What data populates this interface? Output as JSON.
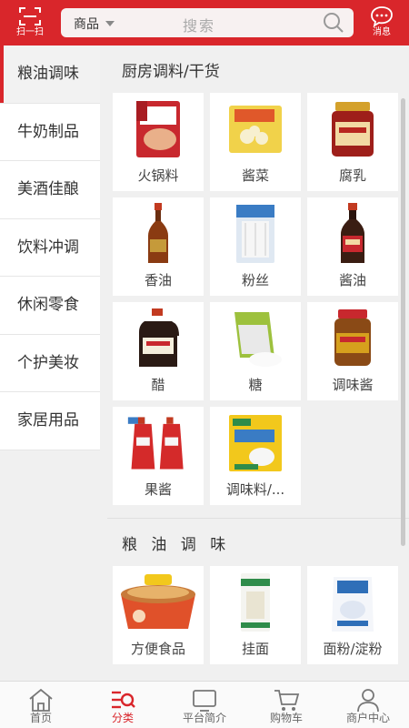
{
  "header": {
    "scan_label": "扫一扫",
    "search_category": "商品",
    "search_placeholder": "搜索",
    "message_label": "消息"
  },
  "sidebar": {
    "items": [
      {
        "label": "粮油调味",
        "active": true
      },
      {
        "label": "牛奶制品"
      },
      {
        "label": "美酒佳酿"
      },
      {
        "label": "饮料冲调"
      },
      {
        "label": "休闲零食"
      },
      {
        "label": "个护美妆"
      },
      {
        "label": "家居用品"
      }
    ]
  },
  "sections": [
    {
      "title": "厨房调料/干货",
      "items": [
        {
          "name": "火锅料",
          "icon": "hotpot-package-icon",
          "color": "#c8282e"
        },
        {
          "name": "酱菜",
          "icon": "pickles-package-icon",
          "color": "#e8c23a"
        },
        {
          "name": "腐乳",
          "icon": "fermented-tofu-jar-icon",
          "color": "#b8261f"
        },
        {
          "name": "香油",
          "icon": "sesame-oil-bottle-icon",
          "color": "#8a3b12"
        },
        {
          "name": "粉丝",
          "icon": "vermicelli-package-icon",
          "color": "#3a7cc4"
        },
        {
          "name": "酱油",
          "icon": "soy-sauce-bottle-icon",
          "color": "#3a1d12"
        },
        {
          "name": "醋",
          "icon": "vinegar-jug-icon",
          "color": "#2a1a14"
        },
        {
          "name": "糖",
          "icon": "sugar-bag-icon",
          "color": "#9dc13d"
        },
        {
          "name": "调味酱",
          "icon": "seasoning-sauce-jar-icon",
          "color": "#d6a01d"
        },
        {
          "name": "果酱",
          "icon": "ketchup-pouch-icon",
          "color": "#d42a2a"
        },
        {
          "name": "调味料/...",
          "icon": "seasoning-pack-icon",
          "color": "#f2c81c"
        }
      ]
    },
    {
      "title": "粮 油 调 味",
      "items": [
        {
          "name": "方便食品",
          "icon": "instant-noodle-icon",
          "color": "#e0512a"
        },
        {
          "name": "挂面",
          "icon": "dried-noodle-package-icon",
          "color": "#2f8c4a"
        },
        {
          "name": "面粉/淀粉",
          "icon": "flour-bag-icon",
          "color": "#2f6fb8"
        }
      ]
    }
  ],
  "bottom_nav": [
    {
      "label": "首页",
      "icon": "home-icon"
    },
    {
      "label": "分类",
      "icon": "category-icon",
      "active": true
    },
    {
      "label": "平台简介",
      "icon": "platform-intro-icon"
    },
    {
      "label": "购物车",
      "icon": "cart-icon"
    },
    {
      "label": "商户中心",
      "icon": "merchant-center-icon"
    }
  ],
  "colors": {
    "accent": "#d9262b",
    "background": "#f0f0f0"
  }
}
